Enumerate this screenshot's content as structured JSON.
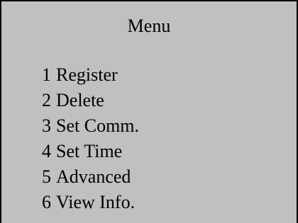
{
  "menu": {
    "title": "Menu",
    "items": [
      {
        "number": "1",
        "label": "Register"
      },
      {
        "number": "2",
        "label": "Delete"
      },
      {
        "number": "3",
        "label": "Set Comm."
      },
      {
        "number": "4",
        "label": "Set Time"
      },
      {
        "number": "5",
        "label": "Advanced"
      },
      {
        "number": "6",
        "label": "View Info."
      }
    ]
  },
  "colors": {
    "background": "#c0c0c0",
    "border": "#000000",
    "text": "#000000"
  }
}
